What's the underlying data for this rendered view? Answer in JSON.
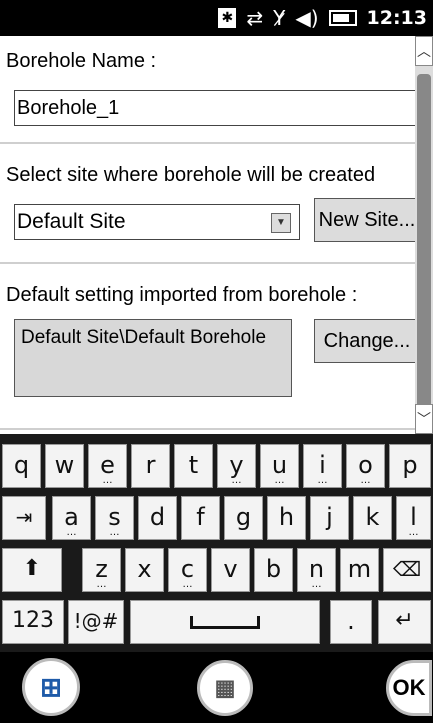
{
  "status_bar": {
    "bluetooth_icon": "bluetooth-icon",
    "sync_icon": "sync-icon",
    "signal_icon": "no-signal-icon",
    "volume_icon": "volume-icon",
    "battery_icon": "battery-icon",
    "time": "12:13"
  },
  "form": {
    "borehole_name_label": "Borehole Name :",
    "borehole_name_value": "Borehole_1",
    "site_label": "Select site where borehole will be created",
    "site_selected": "Default Site",
    "new_site_button": "New Site...",
    "default_setting_label": "Default setting imported from borehole :",
    "default_setting_value": "Default Site\\Default Borehole",
    "change_button": "Change..."
  },
  "keyboard": {
    "row1": [
      "q",
      "w",
      "e",
      "r",
      "t",
      "y",
      "u",
      "i",
      "o",
      "p"
    ],
    "row2": [
      "a",
      "s",
      "d",
      "f",
      "g",
      "h",
      "j",
      "k",
      "l"
    ],
    "row3": [
      "z",
      "x",
      "c",
      "v",
      "b",
      "n",
      "m"
    ],
    "row4": {
      "numbers": "123",
      "symbols": "!@#",
      "period": "."
    }
  },
  "bottom_bar": {
    "start_icon": "windows-start-icon",
    "keyboard_icon": "keyboard-icon",
    "ok_label": "OK"
  }
}
